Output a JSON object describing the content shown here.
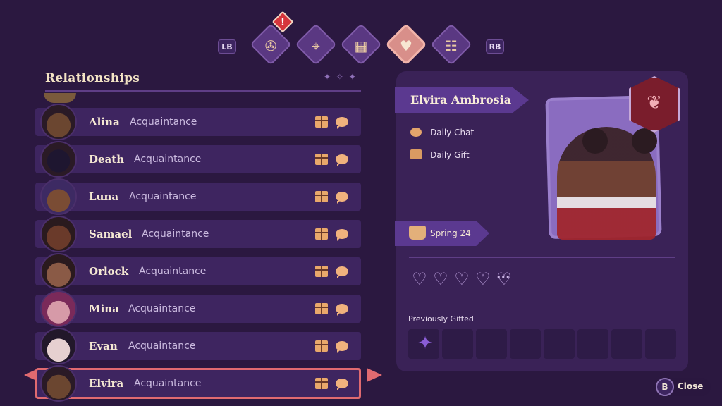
{
  "tabbar": {
    "left_shoulder": "LB",
    "right_shoulder": "RB",
    "alert_mark": "!",
    "tabs": [
      {
        "icon": "quest-scroll-icon",
        "active": false,
        "glyph": "✇"
      },
      {
        "icon": "map-icon",
        "active": false,
        "glyph": "⌖"
      },
      {
        "icon": "calendar-icon",
        "active": false,
        "glyph": "▦"
      },
      {
        "icon": "heart-icon",
        "active": true,
        "glyph": "♥"
      },
      {
        "icon": "book-icon",
        "active": false,
        "glyph": "☷"
      }
    ]
  },
  "relationships": {
    "title": "Relationships",
    "rows": [
      {
        "name": "Alina",
        "status": "Acquaintance"
      },
      {
        "name": "Death",
        "status": "Acquaintance"
      },
      {
        "name": "Luna",
        "status": "Acquaintance"
      },
      {
        "name": "Samael",
        "status": "Acquaintance"
      },
      {
        "name": "Orlock",
        "status": "Acquaintance"
      },
      {
        "name": "Mina",
        "status": "Acquaintance"
      },
      {
        "name": "Evan",
        "status": "Acquaintance"
      },
      {
        "name": "Elvira",
        "status": "Acquaintance",
        "selected": true
      }
    ]
  },
  "detail": {
    "name": "Elvira Ambrosia",
    "daily_chat": "Daily Chat",
    "daily_gift": "Daily Gift",
    "birthday": "Spring 24",
    "hearts_filled": 0,
    "hearts_total": 5,
    "heart_glyph": "♡",
    "previously_gifted_label": "Previously Gifted",
    "gift_slots": 8,
    "gifted_item_glyph": "✦"
  },
  "footer": {
    "close_key": "B",
    "close_label": "Close"
  },
  "colors": {
    "background": "#2b1840",
    "row": "#3e2560",
    "selected_border": "#e06a70",
    "accent_tab": "#d88f8a"
  }
}
